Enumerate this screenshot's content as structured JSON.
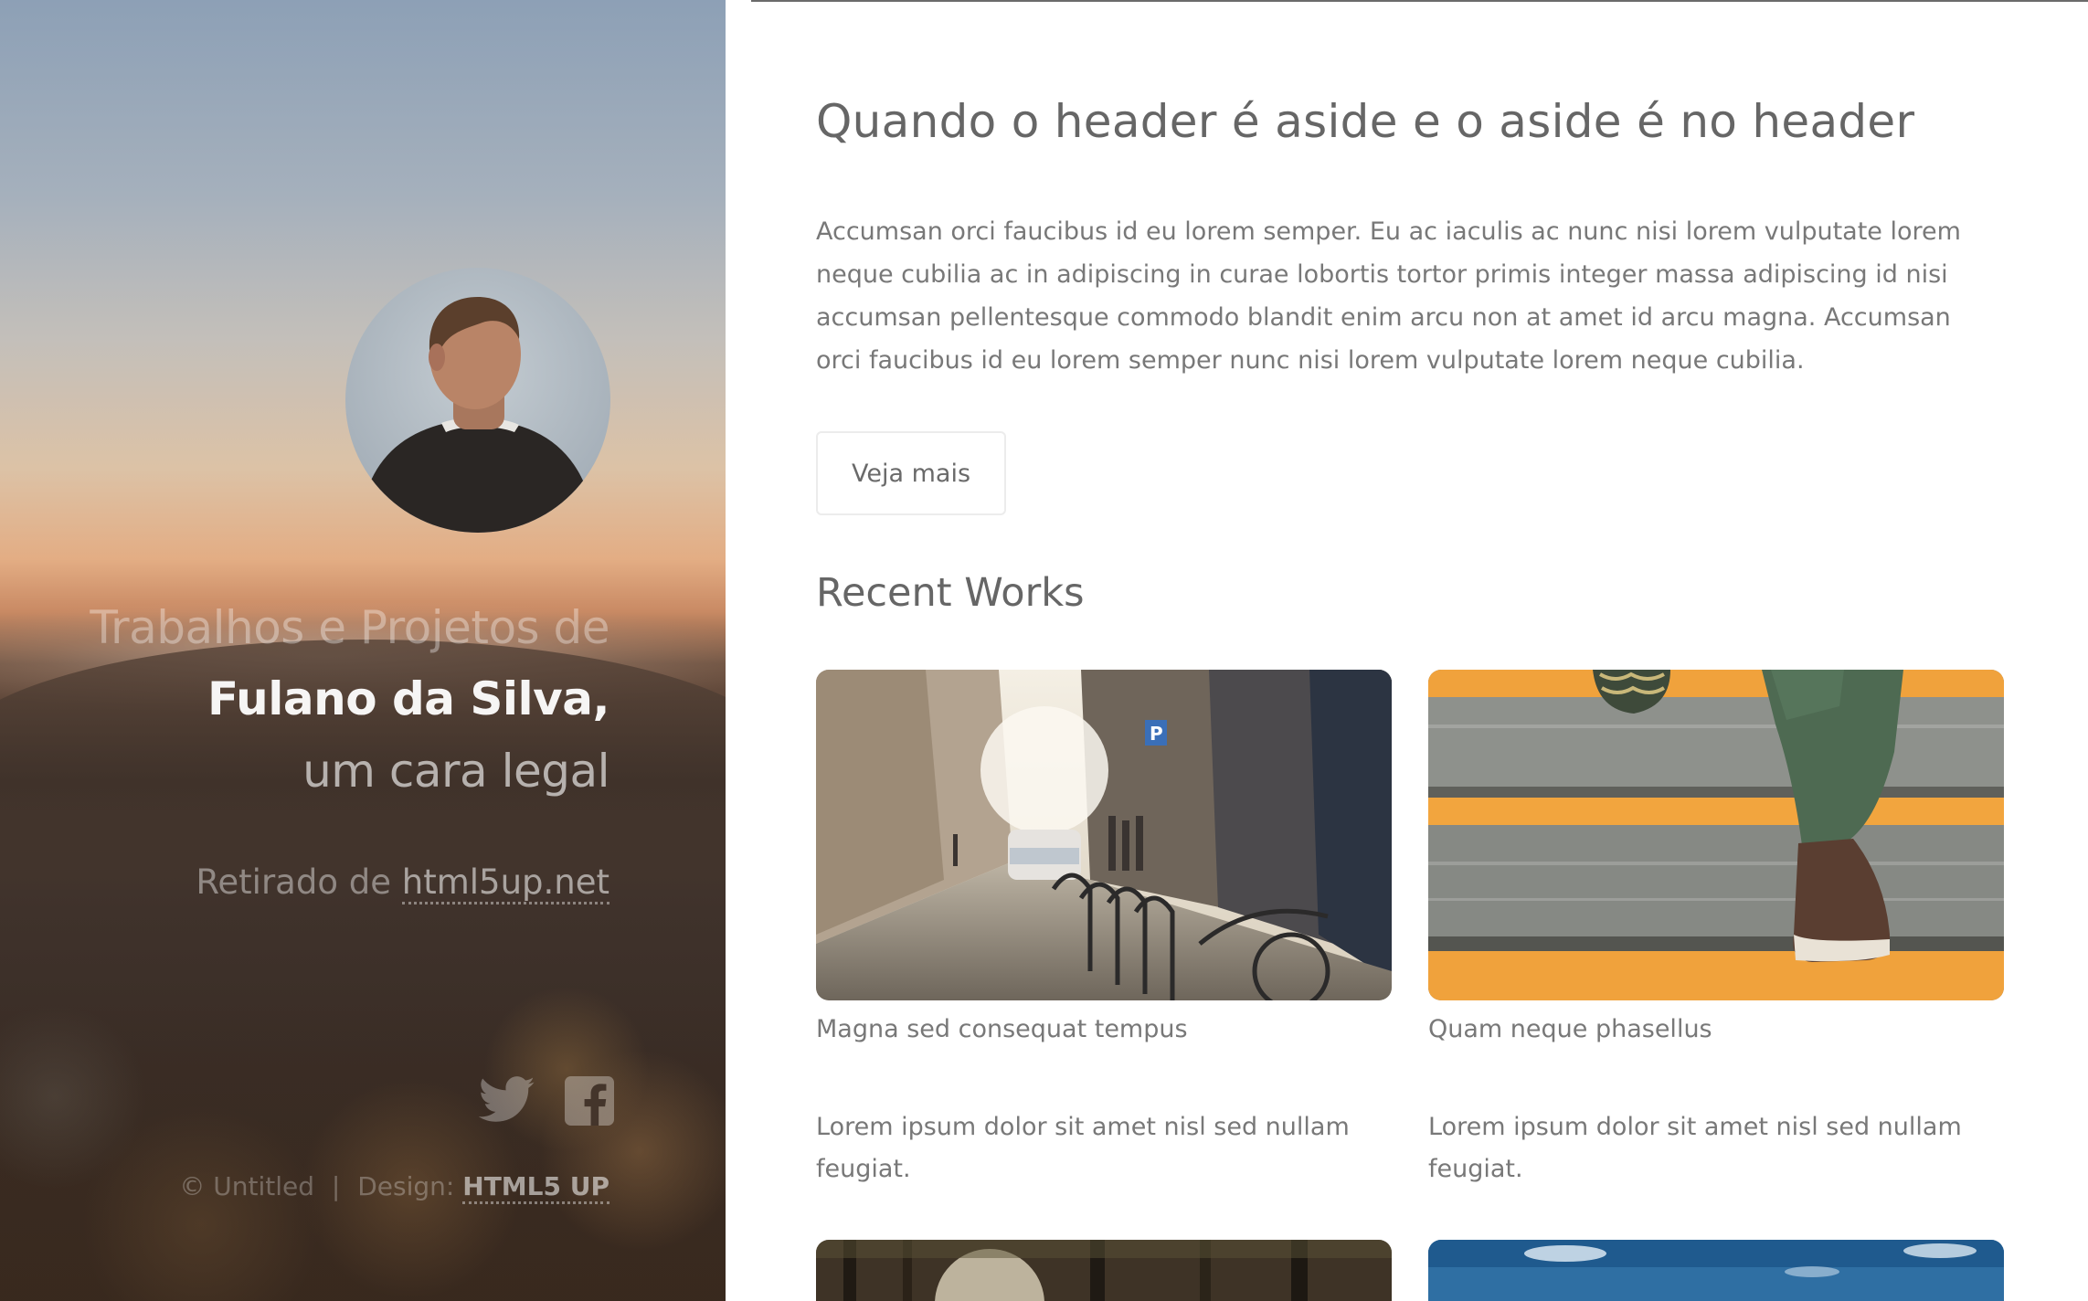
{
  "sidebar": {
    "headline_line1": "Trabalhos e Projetos de",
    "headline_line2": "Fulano da Silva,",
    "headline_line3": "um cara legal",
    "source_prefix": "Retirado de",
    "source_link": "html5up.net",
    "social": [
      {
        "icon": "twitter-icon"
      },
      {
        "icon": "facebook-icon"
      }
    ],
    "footer_copyright": "© Untitled",
    "footer_separator": "|",
    "footer_design_label": "Design:",
    "footer_design_link": "HTML5 UP"
  },
  "main": {
    "title": "Quando o header é aside e o aside é no header",
    "intro": "Accumsan orci faucibus id eu lorem semper. Eu ac iaculis ac nunc nisi lorem vulputate lorem neque cubilia ac in adipiscing in curae lobortis tortor primis integer massa adipiscing id nisi accumsan pellentesque commodo blandit enim arcu non at amet id arcu magna. Accumsan orci faucibus id eu lorem semper nunc nisi lorem vulputate lorem neque cubilia.",
    "more_button": "Veja mais",
    "recent_title": "Recent Works",
    "works": [
      {
        "caption": "Magna sed consequat tempus",
        "description": "Lorem ipsum dolor sit amet nisl sed nullam feugiat."
      },
      {
        "caption": "Quam neque phasellus",
        "description": "Lorem ipsum dolor sit amet nisl sed nullam feugiat."
      }
    ],
    "parking_sign": "P"
  },
  "colors": {
    "accent_orange": "#f0a23c",
    "text_gray": "#787878",
    "title_gray": "#666666"
  }
}
